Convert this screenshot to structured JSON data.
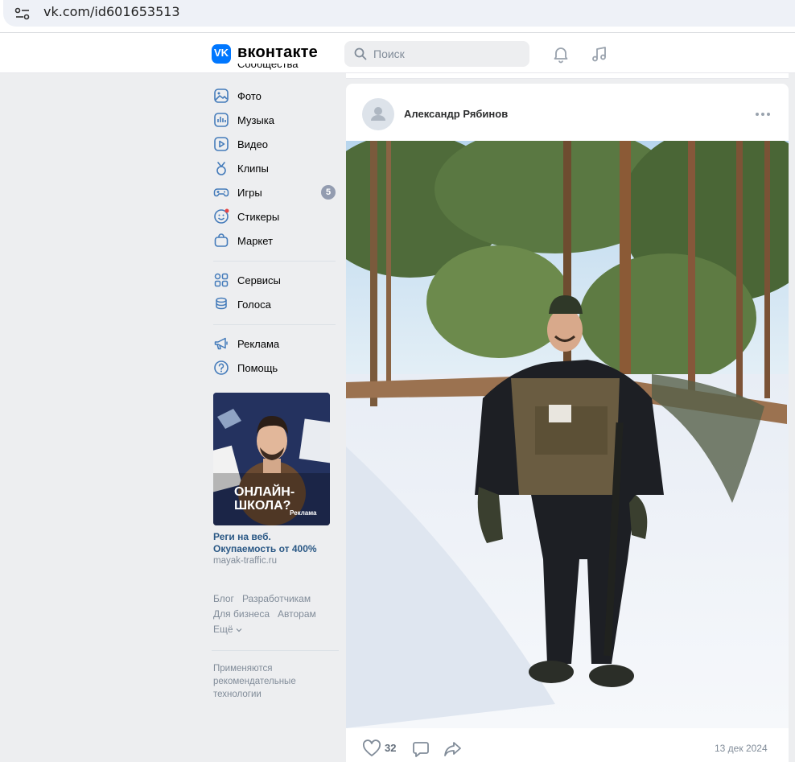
{
  "browser": {
    "url": "vk.com/id601653513"
  },
  "header": {
    "brand": "вконтакте",
    "search_placeholder": "Поиск"
  },
  "menu": {
    "top_cut": "Сообщества",
    "items": [
      {
        "label": "Фото",
        "icon": "photo-icon"
      },
      {
        "label": "Музыка",
        "icon": "music-icon"
      },
      {
        "label": "Видео",
        "icon": "video-icon"
      },
      {
        "label": "Клипы",
        "icon": "clips-icon"
      },
      {
        "label": "Игры",
        "icon": "games-icon",
        "badge": "5"
      },
      {
        "label": "Стикеры",
        "icon": "stickers-icon"
      },
      {
        "label": "Маркет",
        "icon": "market-icon"
      },
      {
        "label": "Сервисы",
        "icon": "services-icon"
      },
      {
        "label": "Голоса",
        "icon": "votes-icon"
      },
      {
        "label": "Реклама",
        "icon": "ads-icon"
      },
      {
        "label": "Помощь",
        "icon": "help-icon"
      }
    ]
  },
  "ad": {
    "image_text": "ОНЛАЙН-ШКОЛА?",
    "image_badge": "Реклама",
    "title_line1": "Реги на веб.",
    "title_line2": "Окупаемость от 400%",
    "domain": "mayak-traffic.ru"
  },
  "footer": {
    "links": [
      "Блог",
      "Разработчикам",
      "Для бизнеса",
      "Авторам",
      "Ещё"
    ],
    "note": "Применяются рекомендательные технологии"
  },
  "post": {
    "author": "Александр Рябинов",
    "likes": "32",
    "date": "13 дек 2024"
  },
  "colors": {
    "accent": "#0077ff",
    "link": "#2a5885",
    "muted": "#818c99",
    "background": "#edeef0"
  }
}
